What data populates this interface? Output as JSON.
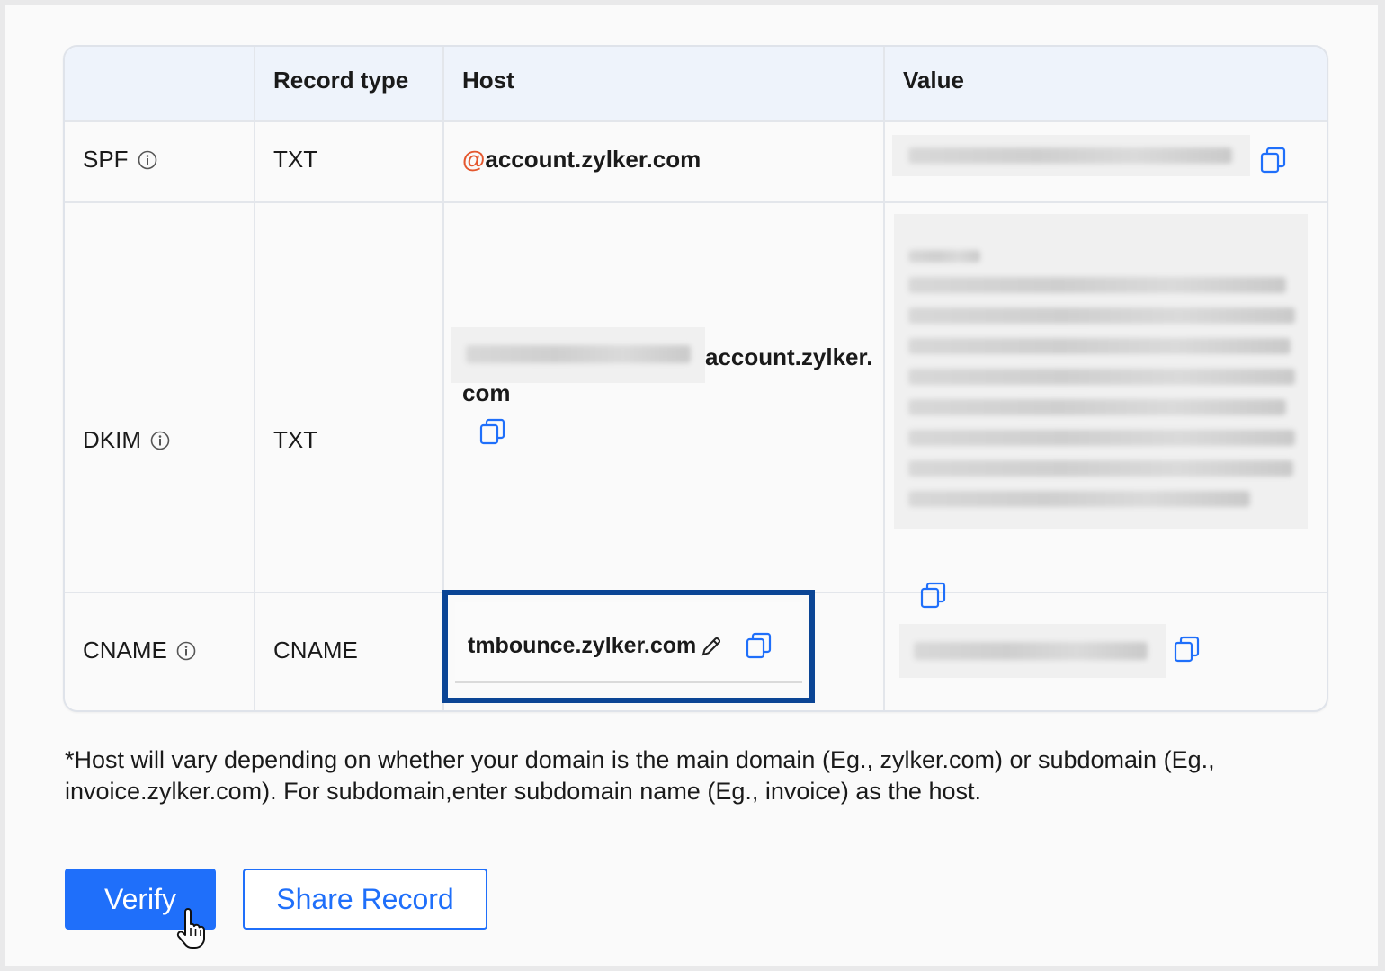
{
  "table": {
    "headers": [
      "",
      "Record type",
      "Host",
      "Value"
    ],
    "rows": [
      {
        "name": "SPF",
        "record_type": "TXT",
        "host_at": "@",
        "host": "account.zylker.com"
      },
      {
        "name": "DKIM",
        "record_type": "TXT",
        "host_line1": "account.zylker.",
        "host_line2": "com"
      },
      {
        "name": "CNAME",
        "record_type": "CNAME",
        "host": "tmbounce.zylker.com"
      }
    ]
  },
  "note": "*Host will vary depending on whether your domain is the main domain (Eg., zylker.com) or subdomain (Eg., invoice.zylker.com). For subdomain,enter subdomain name (Eg., invoice) as the host.",
  "buttons": {
    "verify": "Verify",
    "share": "Share Record"
  },
  "colors": {
    "accent": "#1f6ffa",
    "highlight_border": "#0b4595",
    "at_sign": "#e4572e",
    "header_bg": "#eef3fb"
  },
  "icons": {
    "info": "info-icon",
    "copy": "copy-icon",
    "edit": "pencil-icon",
    "cursor": "hand-pointer-cursor"
  }
}
